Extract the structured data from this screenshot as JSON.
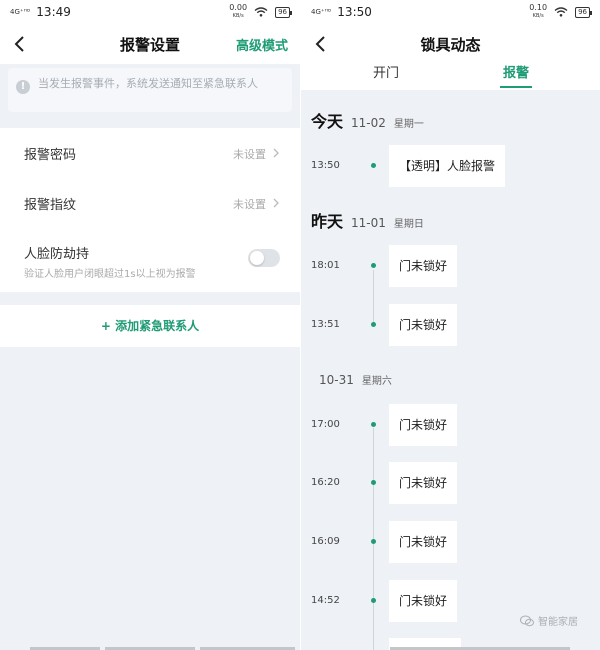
{
  "left": {
    "status": {
      "signal": "4G⁺ᴴᴰ",
      "time": "13:49",
      "net_speed": "0.00",
      "net_unit": "KB/s",
      "battery": "96"
    },
    "nav": {
      "title": "报警设置",
      "action": "高级模式"
    },
    "notice": "当发生报警事件，系统发送通知至紧急联系人",
    "rows": [
      {
        "label": "报警密码",
        "value": "未设置"
      },
      {
        "label": "报警指纹",
        "value": "未设置"
      }
    ],
    "face": {
      "label": "人脸防劫持",
      "sub": "验证人脸用户闭眼超过1s以上视为报警",
      "enabled": false
    },
    "add_contact": "+ 添加紧急联系人"
  },
  "right": {
    "status": {
      "signal": "4G⁺ᴴᴰ",
      "time": "13:50",
      "net_speed": "0.10",
      "net_unit": "KB/s",
      "battery": "96"
    },
    "nav": {
      "title": "锁具动态"
    },
    "tabs": [
      {
        "label": "开门",
        "active": false
      },
      {
        "label": "报警",
        "active": true
      }
    ],
    "groups": [
      {
        "day": "今天",
        "date": "11-02",
        "weekday": "星期一"
      },
      {
        "day": "昨天",
        "date": "11-01",
        "weekday": "星期日"
      },
      {
        "day": "",
        "date": "10-31",
        "weekday": "星期六"
      }
    ],
    "events": [
      {
        "time": "13:50",
        "text": "【透明】人脸报警"
      },
      {
        "time": "18:01",
        "text": "门未锁好"
      },
      {
        "time": "13:51",
        "text": "门未锁好"
      },
      {
        "time": "17:00",
        "text": "门未锁好"
      },
      {
        "time": "16:20",
        "text": "门未锁好"
      },
      {
        "time": "16:09",
        "text": "门未锁好"
      },
      {
        "time": "14:52",
        "text": "门未锁好"
      }
    ]
  },
  "watermark": "智能家居",
  "colors": {
    "accent": "#1f9b75",
    "background": "#eef1f5"
  }
}
